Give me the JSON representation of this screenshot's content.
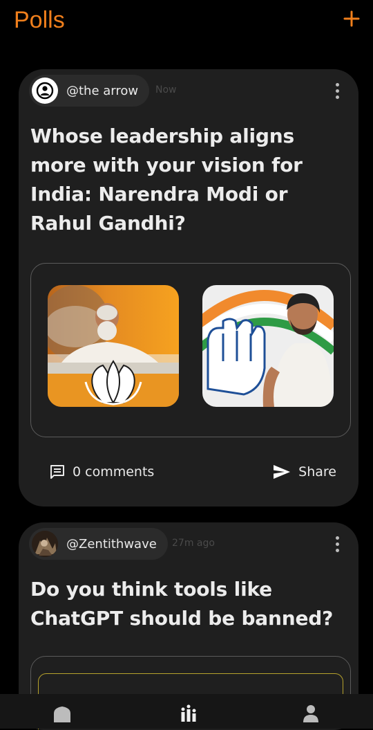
{
  "header": {
    "title": "Polls",
    "add_icon": "plus-icon",
    "accent": "#F07F1C"
  },
  "posts": [
    {
      "username": "@the arrow",
      "time": "Now",
      "question": "Whose leadership aligns more with your vision for India: Narendra Modi or Rahul Gandhi?",
      "options": [
        {
          "image": "narendra-modi-photo"
        },
        {
          "image": "rahul-gandhi-photo"
        }
      ],
      "comments_label": "0 comments",
      "share_label": "Share"
    },
    {
      "username": "@Zentithwave",
      "time": "27m ago",
      "question": "Do you think tools like ChatGPT should be banned?"
    }
  ],
  "nav": {
    "items": [
      {
        "icon": "home-icon"
      },
      {
        "icon": "polls-icon"
      },
      {
        "icon": "profile-icon"
      }
    ]
  }
}
